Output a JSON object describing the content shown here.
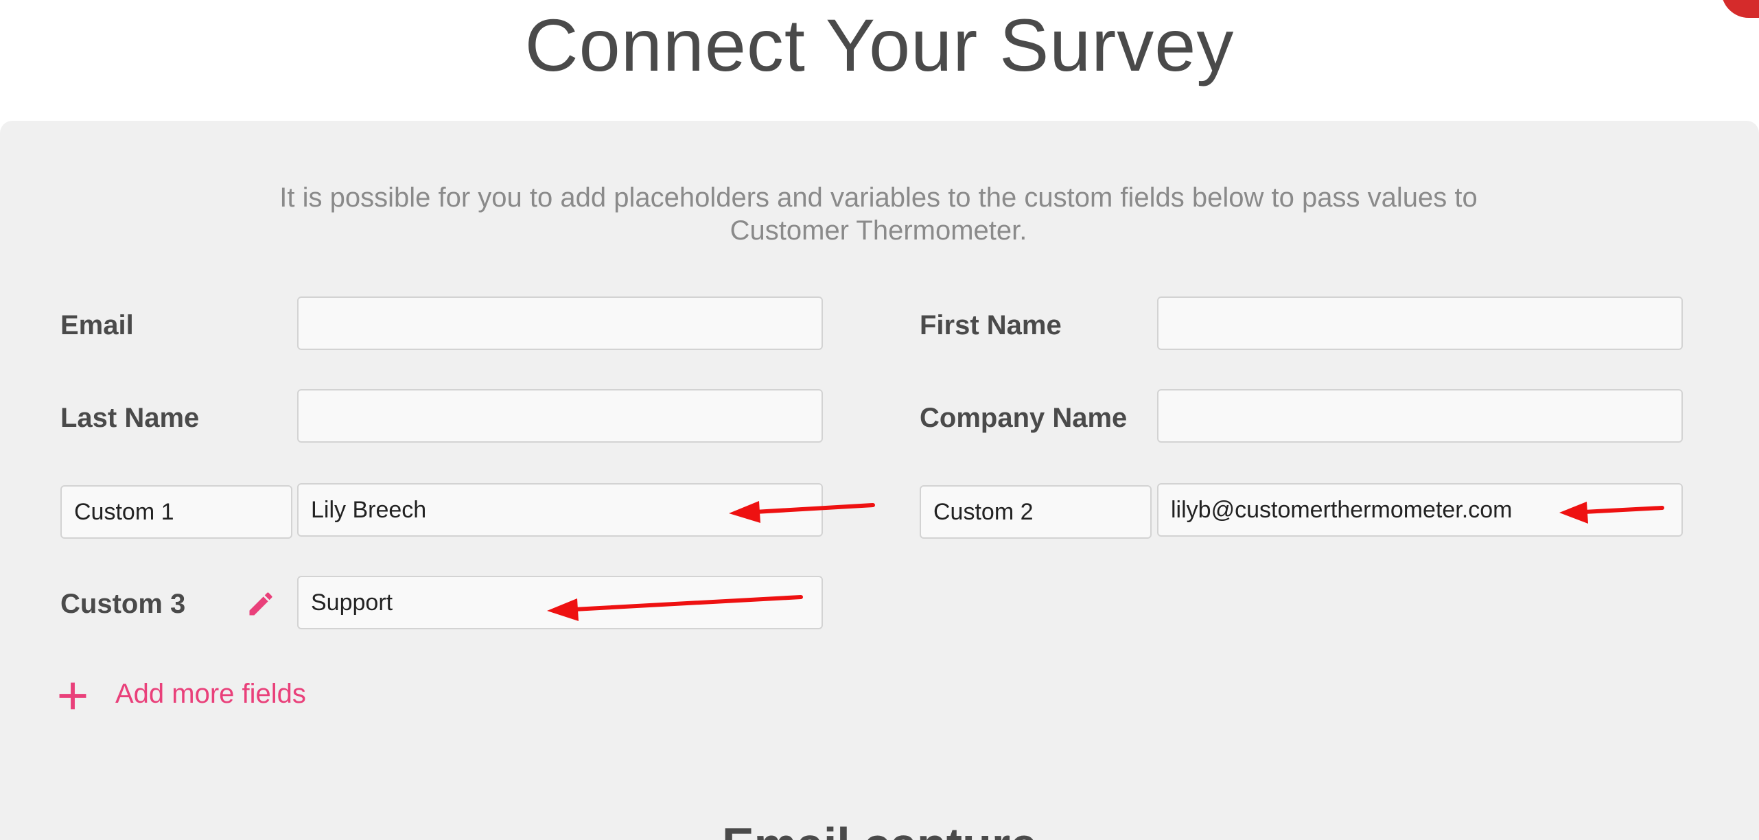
{
  "page": {
    "title": "Connect Your Survey",
    "intro": "It is possible for you to add placeholders and variables to the custom fields below to pass values to Customer Thermometer.",
    "next_section_title": "Email capture"
  },
  "fields": {
    "email": {
      "label": "Email",
      "value": ""
    },
    "first_name": {
      "label": "First Name",
      "value": ""
    },
    "last_name": {
      "label": "Last Name",
      "value": ""
    },
    "company_name": {
      "label": "Company Name",
      "value": ""
    },
    "custom1": {
      "name": "Custom 1",
      "value": "Lily Breech"
    },
    "custom2": {
      "name": "Custom 2",
      "value": "lilyb@customerthermometer.com"
    },
    "custom3": {
      "label": "Custom 3",
      "value": "Support"
    }
  },
  "actions": {
    "add_more_label": "Add more fields"
  },
  "icons": {
    "edit": "pencil-icon",
    "add": "plus-icon",
    "annotation": "red-arrow-icon"
  },
  "colors": {
    "accent": "#e9407a",
    "annotation_arrow": "#ee1111",
    "title_text": "#4a4a4a",
    "panel_bg": "#f0f0f0"
  }
}
